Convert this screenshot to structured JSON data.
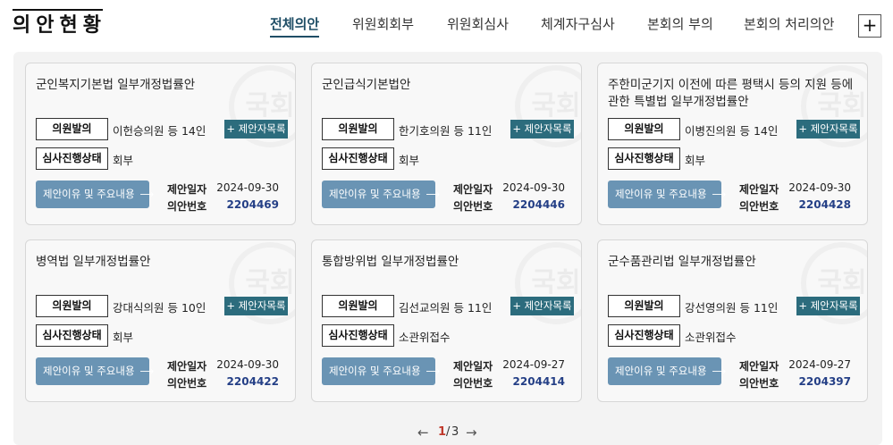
{
  "header": {
    "title": "의안현황",
    "tabs": [
      {
        "label": "전체의안"
      },
      {
        "label": "위원회회부"
      },
      {
        "label": "위원회심사"
      },
      {
        "label": "체계자구심사"
      },
      {
        "label": "본회의 부의"
      },
      {
        "label": "본회의 처리의안"
      }
    ],
    "plus_label": "+"
  },
  "labels": {
    "proposer": "의원발의",
    "status": "심사진행상태",
    "propose_list": "+ 제안자목록",
    "reason": "제안이유 및 주요내용",
    "reason_arrow": "⟶",
    "date_key": "제안일자",
    "number_key": "의안번호"
  },
  "bills": [
    {
      "title": "군인복지기본법 일부개정법률안",
      "proposer": "이헌승의원 등 14인",
      "status": "회부",
      "date": "2024-09-30",
      "number": "2204469"
    },
    {
      "title": "군인급식기본법안",
      "proposer": "한기호의원 등 11인",
      "status": "회부",
      "date": "2024-09-30",
      "number": "2204446"
    },
    {
      "title": "주한미군기지 이전에 따른 평택시 등의 지원 등에 관한 특별법 일부개정법률안",
      "proposer": "이병진의원 등 14인",
      "status": "회부",
      "date": "2024-09-30",
      "number": "2204428"
    },
    {
      "title": "병역법 일부개정법률안",
      "proposer": "강대식의원 등 10인",
      "status": "회부",
      "date": "2024-09-30",
      "number": "2204422"
    },
    {
      "title": "통합방위법 일부개정법률안",
      "proposer": "김선교의원 등 11인",
      "status": "소관위접수",
      "date": "2024-09-27",
      "number": "2204414"
    },
    {
      "title": "군수품관리법 일부개정법률안",
      "proposer": "강선영의원 등 11인",
      "status": "소관위접수",
      "date": "2024-09-27",
      "number": "2204397"
    }
  ],
  "pagination": {
    "current": "1",
    "separator": "/",
    "total": "3",
    "prev": "←",
    "next": "→"
  }
}
